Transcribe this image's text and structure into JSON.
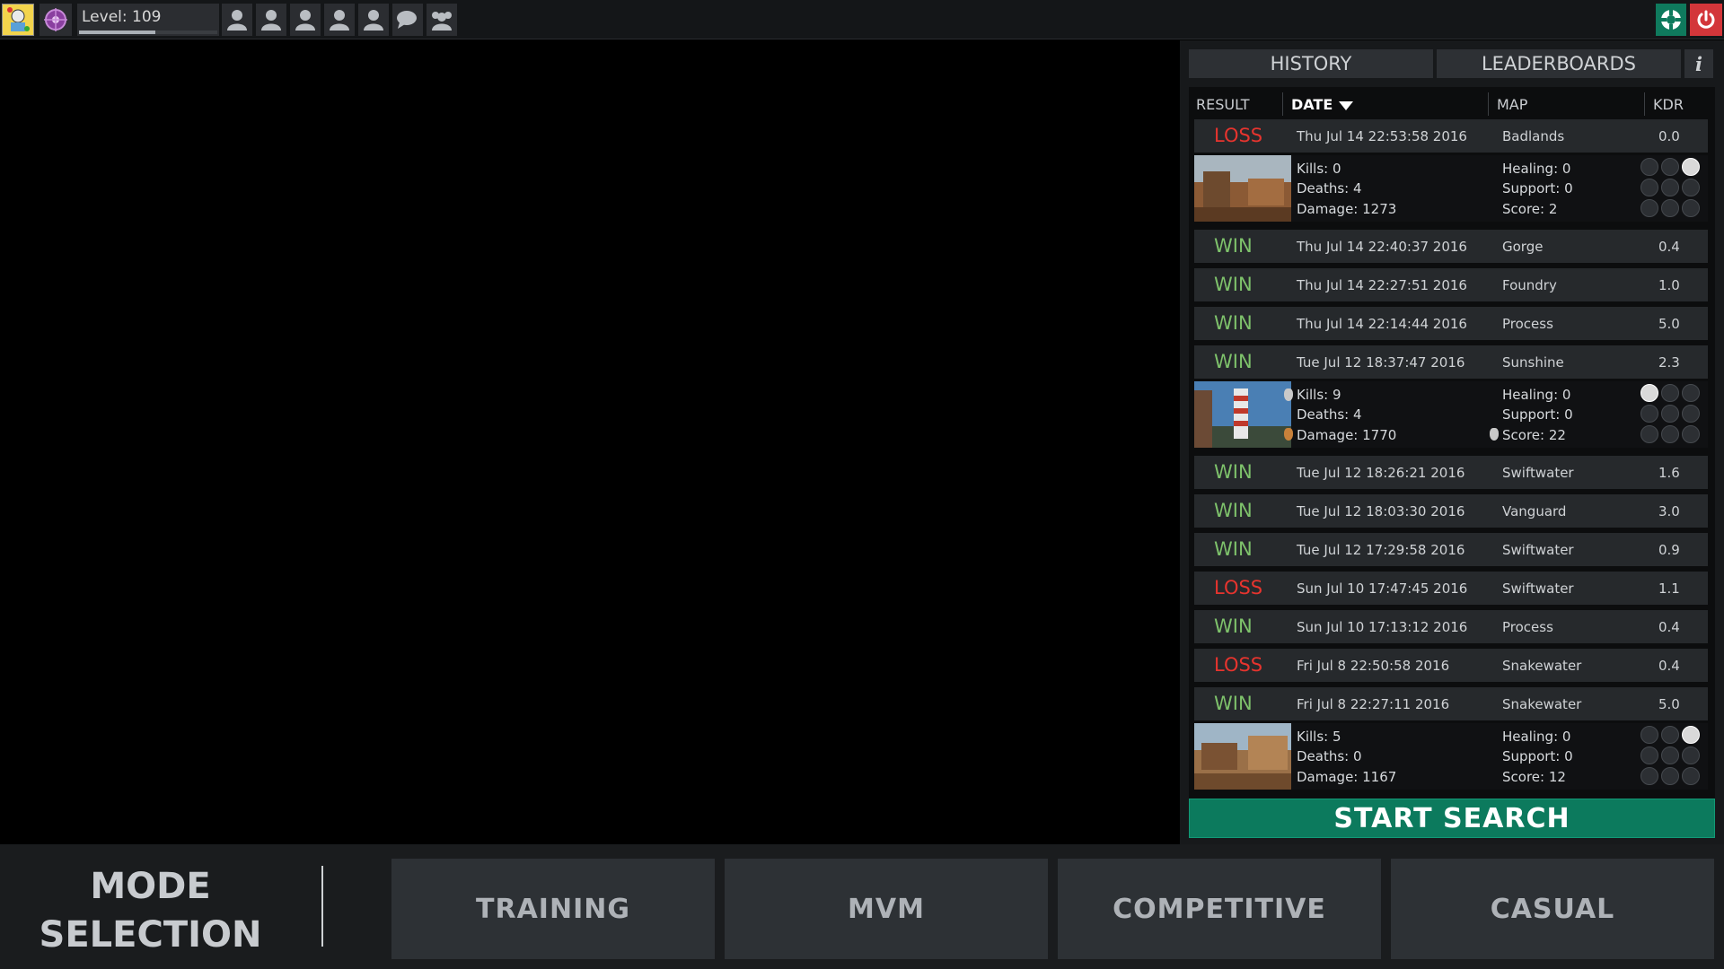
{
  "topbar": {
    "level_text": "Level: 109",
    "level_progress": 0.55,
    "friends": [
      "person-icon",
      "person-icon",
      "person-icon",
      "person-icon",
      "person-icon",
      "chat-icon",
      "party-icon"
    ],
    "support_icon": "lifebuoy-icon",
    "power_icon": "power-icon"
  },
  "tabs": {
    "history": "HISTORY",
    "leaderboards": "LEADERBOARDS",
    "info": "i"
  },
  "columns": {
    "result": "RESULT",
    "date": "DATE",
    "map": "MAP",
    "kdr": "KDR"
  },
  "history": {
    "rows": [
      {
        "result": "LOSS",
        "date": "Thu Jul 14 22:53:58 2016",
        "map": "Badlands",
        "kdr": "0.0"
      },
      {
        "result": "WIN",
        "date": "Thu Jul 14 22:40:37 2016",
        "map": "Gorge",
        "kdr": "0.4"
      },
      {
        "result": "WIN",
        "date": "Thu Jul 14 22:27:51 2016",
        "map": "Foundry",
        "kdr": "1.0"
      },
      {
        "result": "WIN",
        "date": "Thu Jul 14 22:14:44 2016",
        "map": "Process",
        "kdr": "5.0"
      },
      {
        "result": "WIN",
        "date": "Tue Jul 12 18:37:47 2016",
        "map": "Sunshine",
        "kdr": "2.3"
      },
      {
        "result": "WIN",
        "date": "Tue Jul 12 18:26:21 2016",
        "map": "Swiftwater",
        "kdr": "1.6"
      },
      {
        "result": "WIN",
        "date": "Tue Jul 12 18:03:30 2016",
        "map": "Vanguard",
        "kdr": "3.0"
      },
      {
        "result": "WIN",
        "date": "Tue Jul 12 17:29:58 2016",
        "map": "Swiftwater",
        "kdr": "0.9"
      },
      {
        "result": "LOSS",
        "date": "Sun Jul 10 17:47:45 2016",
        "map": "Swiftwater",
        "kdr": "1.1"
      },
      {
        "result": "WIN",
        "date": "Sun Jul 10 17:13:12 2016",
        "map": "Process",
        "kdr": "0.4"
      },
      {
        "result": "LOSS",
        "date": "Fri Jul  8 22:50:58 2016",
        "map": "Snakewater",
        "kdr": "0.4"
      },
      {
        "result": "WIN",
        "date": "Fri Jul  8 22:27:11 2016",
        "map": "Snakewater",
        "kdr": "5.0"
      }
    ],
    "details": [
      {
        "after_row": 0,
        "kills": "Kills: 0",
        "deaths": "Deaths: 4",
        "damage": "Damage: 1273",
        "healing": "Healing: 0",
        "support": "Support: 0",
        "score": "Score: 2",
        "active_class": 2,
        "scene": "desert"
      },
      {
        "after_row": 4,
        "kills": "Kills: 9",
        "deaths": "Deaths: 4",
        "damage": "Damage: 1770",
        "healing": "Healing: 0",
        "support": "Support: 0",
        "score": "Score: 22",
        "active_class": 0,
        "scene": "lighthouse"
      },
      {
        "after_row": 11,
        "kills": "Kills: 5",
        "deaths": "Deaths: 0",
        "damage": "Damage: 1167",
        "healing": "Healing: 0",
        "support": "Support: 0",
        "score": "Score: 12",
        "active_class": 2,
        "scene": "western"
      }
    ]
  },
  "start_search": "START SEARCH",
  "bottom": {
    "title_line1": "MODE",
    "title_line2": "SELECTION",
    "modes": [
      "TRAINING",
      "MVM",
      "COMPETITIVE",
      "CASUAL"
    ]
  },
  "colors": {
    "win": "#7ec26b",
    "loss": "#e7342e",
    "accent": "#0c7a5d",
    "power": "#d3363a"
  }
}
